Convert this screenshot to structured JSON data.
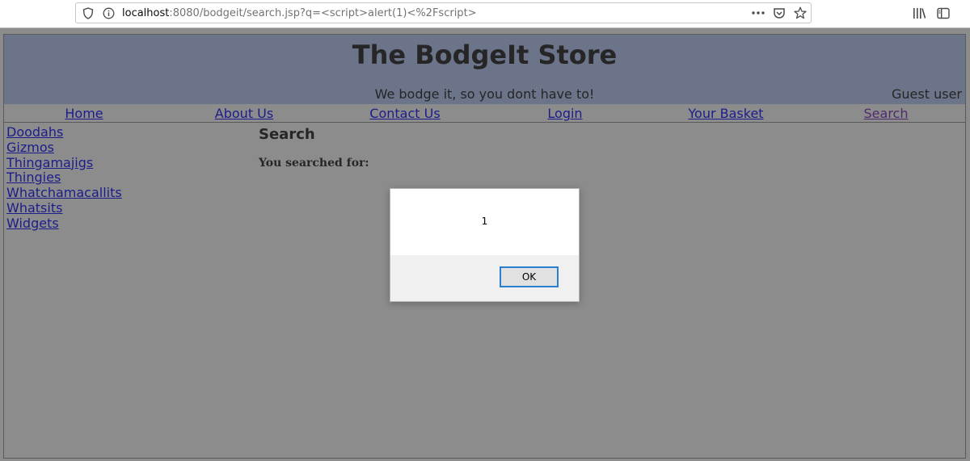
{
  "browser": {
    "url_host": "localhost",
    "url_rest": ":8080/bodgeit/search.jsp?q=<script>alert(1)<%2Fscript>",
    "icons": [
      "shield-icon",
      "info-icon",
      "more-icon",
      "pocket-icon",
      "star-icon",
      "library-icon",
      "sidebar-icon"
    ]
  },
  "header": {
    "title": "The BodgeIt Store",
    "tagline": "We bodge it, so you dont have to!",
    "user": "Guest user"
  },
  "nav": {
    "items": [
      "Home",
      "About Us",
      "Contact Us",
      "Login",
      "Your Basket",
      "Search"
    ]
  },
  "sidebar": {
    "items": [
      "Doodahs",
      "Gizmos",
      "Thingamajigs",
      "Thingies",
      "Whatchamacallits",
      "Whatsits",
      "Widgets"
    ]
  },
  "main": {
    "title": "Search",
    "searched_label": "You searched for:"
  },
  "dialog": {
    "message": "1",
    "ok_label": "OK"
  },
  "colors": {
    "header_bg": "#6b7489",
    "page_bg": "#8c8c8c",
    "link": "#1c1c8c",
    "focus": "#2b7fd0"
  }
}
